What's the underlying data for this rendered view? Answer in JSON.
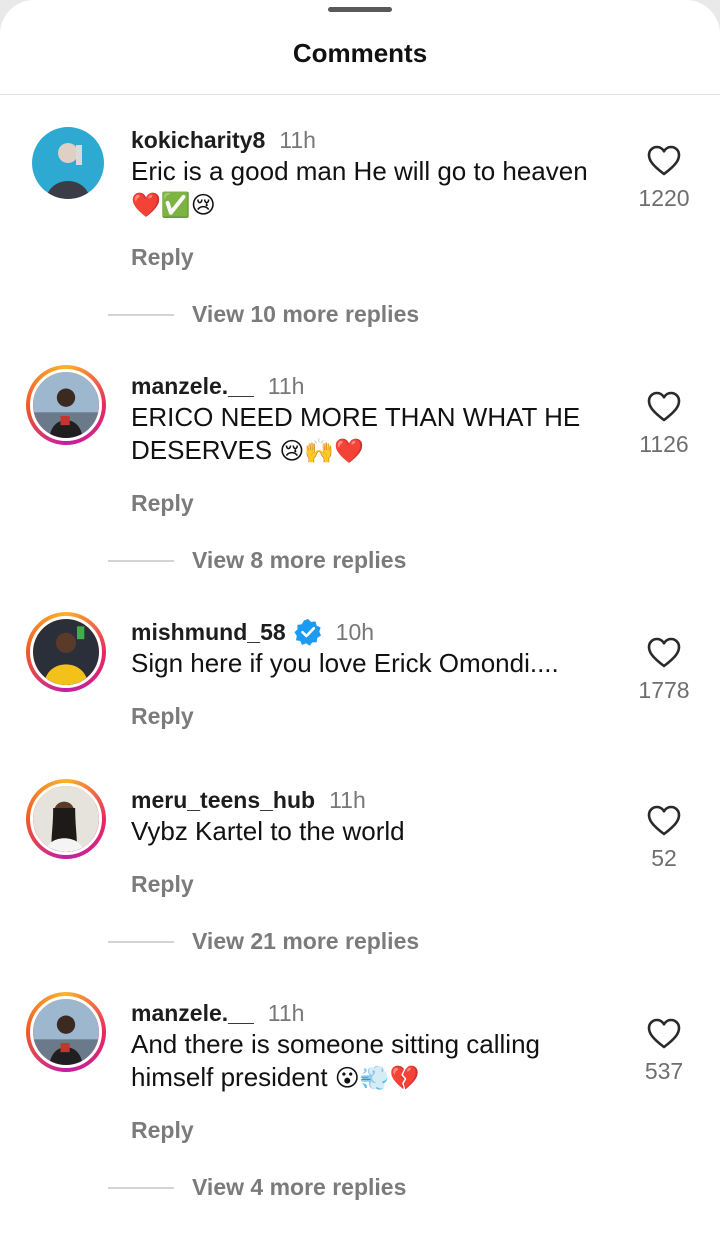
{
  "sheet": {
    "title": "Comments"
  },
  "comments": [
    {
      "username": "kokicharity8",
      "time": "11h",
      "text": "Eric is a good man He will go to heaven",
      "emojis": "❤️✅😢",
      "reply_label": "Reply",
      "likes": "1220",
      "view_replies": "View 10 more replies",
      "avatar_ring": false,
      "verified": false
    },
    {
      "username": "manzele.__",
      "time": "11h",
      "text": "ERICO NEED MORE THAN WHAT HE DESERVES",
      "emojis": "😢🙌❤️",
      "reply_label": "Reply",
      "likes": "1126",
      "view_replies": "View 8 more replies",
      "avatar_ring": true,
      "verified": false
    },
    {
      "username": "mishmund_58",
      "time": "10h",
      "text": "Sign here if you love Erick Omondi....",
      "emojis": "",
      "reply_label": "Reply",
      "likes": "1778",
      "view_replies": "",
      "avatar_ring": true,
      "verified": true
    },
    {
      "username": "meru_teens_hub",
      "time": "11h",
      "text": "Vybz Kartel to the world",
      "emojis": "",
      "reply_label": "Reply",
      "likes": "52",
      "view_replies": "View 21 more replies",
      "avatar_ring": true,
      "verified": false
    },
    {
      "username": "manzele.__",
      "time": "11h",
      "text": "And there is someone sitting calling himself president",
      "emojis": "😮💨💔",
      "reply_label": "Reply",
      "likes": "537",
      "view_replies": "View 4 more replies",
      "avatar_ring": true,
      "verified": false
    }
  ],
  "icons": {
    "like": "heart-outline-icon",
    "verified": "verified-badge-icon"
  },
  "colors": {
    "verified": "#1d9bf0",
    "secondary_text": "#777777",
    "ring_start": "#f9b32a",
    "ring_end": "#c21fa3"
  }
}
